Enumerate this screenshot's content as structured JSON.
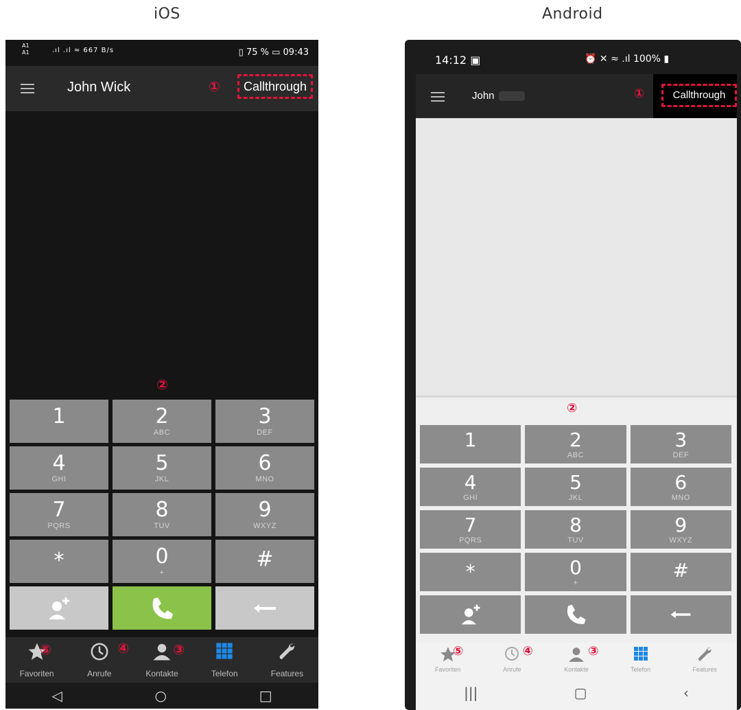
{
  "labels": {
    "ios": "iOS",
    "android": "Android"
  },
  "markers": {
    "m1": "①",
    "m2": "②",
    "m3": "③",
    "m4": "④",
    "m5": "⑤"
  },
  "ios": {
    "status": {
      "carrier": "A1",
      "carrier2": "A1",
      "speed": "667 B/s",
      "battery": "75 %",
      "time": "09:43"
    },
    "user_name": "John Wick",
    "callthrough": "Callthrough"
  },
  "android": {
    "status": {
      "time": "14:12",
      "battery": "100%"
    },
    "user_name": "John",
    "callthrough": "Callthrough"
  },
  "keys": [
    {
      "digit": "1",
      "letters": ""
    },
    {
      "digit": "2",
      "letters": "ABC"
    },
    {
      "digit": "3",
      "letters": "DEF"
    },
    {
      "digit": "4",
      "letters": "GHI"
    },
    {
      "digit": "5",
      "letters": "JKL"
    },
    {
      "digit": "6",
      "letters": "MNO"
    },
    {
      "digit": "7",
      "letters": "PQRS"
    },
    {
      "digit": "8",
      "letters": "TUV"
    },
    {
      "digit": "9",
      "letters": "WXYZ"
    },
    {
      "digit": "*",
      "letters": ""
    },
    {
      "digit": "0",
      "letters": "+"
    },
    {
      "digit": "#",
      "letters": ""
    }
  ],
  "nav": [
    {
      "label": "Favoriten",
      "icon": "star-icon"
    },
    {
      "label": "Anrufe",
      "icon": "clock-icon"
    },
    {
      "label": "Kontakte",
      "icon": "person-icon"
    },
    {
      "label": "Telefon",
      "icon": "dialpad-icon"
    },
    {
      "label": "Features",
      "icon": "wrench-icon"
    }
  ],
  "colors": {
    "accent_marker": "#e0143c",
    "call_green": "#8bc34a",
    "active_tab": "#1e88e5",
    "key_gray": "#8a8a8a"
  }
}
